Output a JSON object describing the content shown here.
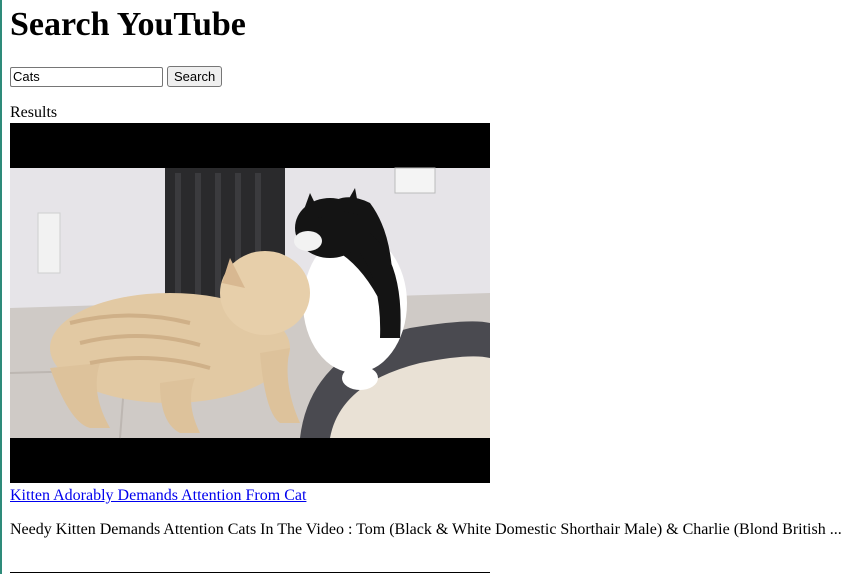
{
  "page": {
    "title": "Search YouTube"
  },
  "search": {
    "value": "Cats",
    "button_label": "Search"
  },
  "results": {
    "label": "Results",
    "items": [
      {
        "title": "Kitten Adorably Demands Attention From Cat",
        "description": "Needy Kitten Demands Attention Cats In The Video : Tom (Black & White Domestic Shorthair Male) & Charlie (Blond British ...",
        "thumbnail": "video-thumbnail"
      }
    ]
  },
  "colors": {
    "link": "#0000ee",
    "left_edge": "#2e8b7a"
  }
}
